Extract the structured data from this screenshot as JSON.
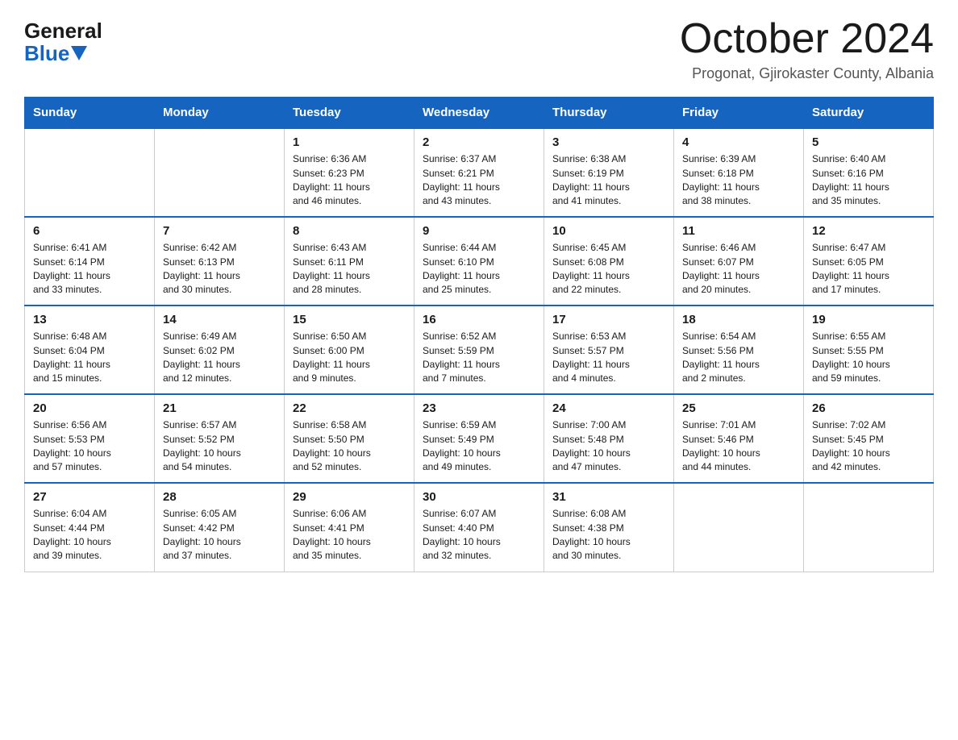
{
  "header": {
    "logo_general": "General",
    "logo_blue": "Blue",
    "title": "October 2024",
    "location": "Progonat, Gjirokaster County, Albania"
  },
  "days_of_week": [
    "Sunday",
    "Monday",
    "Tuesday",
    "Wednesday",
    "Thursday",
    "Friday",
    "Saturday"
  ],
  "weeks": [
    [
      {
        "day": "",
        "info": []
      },
      {
        "day": "",
        "info": []
      },
      {
        "day": "1",
        "info": [
          "Sunrise: 6:36 AM",
          "Sunset: 6:23 PM",
          "Daylight: 11 hours",
          "and 46 minutes."
        ]
      },
      {
        "day": "2",
        "info": [
          "Sunrise: 6:37 AM",
          "Sunset: 6:21 PM",
          "Daylight: 11 hours",
          "and 43 minutes."
        ]
      },
      {
        "day": "3",
        "info": [
          "Sunrise: 6:38 AM",
          "Sunset: 6:19 PM",
          "Daylight: 11 hours",
          "and 41 minutes."
        ]
      },
      {
        "day": "4",
        "info": [
          "Sunrise: 6:39 AM",
          "Sunset: 6:18 PM",
          "Daylight: 11 hours",
          "and 38 minutes."
        ]
      },
      {
        "day": "5",
        "info": [
          "Sunrise: 6:40 AM",
          "Sunset: 6:16 PM",
          "Daylight: 11 hours",
          "and 35 minutes."
        ]
      }
    ],
    [
      {
        "day": "6",
        "info": [
          "Sunrise: 6:41 AM",
          "Sunset: 6:14 PM",
          "Daylight: 11 hours",
          "and 33 minutes."
        ]
      },
      {
        "day": "7",
        "info": [
          "Sunrise: 6:42 AM",
          "Sunset: 6:13 PM",
          "Daylight: 11 hours",
          "and 30 minutes."
        ]
      },
      {
        "day": "8",
        "info": [
          "Sunrise: 6:43 AM",
          "Sunset: 6:11 PM",
          "Daylight: 11 hours",
          "and 28 minutes."
        ]
      },
      {
        "day": "9",
        "info": [
          "Sunrise: 6:44 AM",
          "Sunset: 6:10 PM",
          "Daylight: 11 hours",
          "and 25 minutes."
        ]
      },
      {
        "day": "10",
        "info": [
          "Sunrise: 6:45 AM",
          "Sunset: 6:08 PM",
          "Daylight: 11 hours",
          "and 22 minutes."
        ]
      },
      {
        "day": "11",
        "info": [
          "Sunrise: 6:46 AM",
          "Sunset: 6:07 PM",
          "Daylight: 11 hours",
          "and 20 minutes."
        ]
      },
      {
        "day": "12",
        "info": [
          "Sunrise: 6:47 AM",
          "Sunset: 6:05 PM",
          "Daylight: 11 hours",
          "and 17 minutes."
        ]
      }
    ],
    [
      {
        "day": "13",
        "info": [
          "Sunrise: 6:48 AM",
          "Sunset: 6:04 PM",
          "Daylight: 11 hours",
          "and 15 minutes."
        ]
      },
      {
        "day": "14",
        "info": [
          "Sunrise: 6:49 AM",
          "Sunset: 6:02 PM",
          "Daylight: 11 hours",
          "and 12 minutes."
        ]
      },
      {
        "day": "15",
        "info": [
          "Sunrise: 6:50 AM",
          "Sunset: 6:00 PM",
          "Daylight: 11 hours",
          "and 9 minutes."
        ]
      },
      {
        "day": "16",
        "info": [
          "Sunrise: 6:52 AM",
          "Sunset: 5:59 PM",
          "Daylight: 11 hours",
          "and 7 minutes."
        ]
      },
      {
        "day": "17",
        "info": [
          "Sunrise: 6:53 AM",
          "Sunset: 5:57 PM",
          "Daylight: 11 hours",
          "and 4 minutes."
        ]
      },
      {
        "day": "18",
        "info": [
          "Sunrise: 6:54 AM",
          "Sunset: 5:56 PM",
          "Daylight: 11 hours",
          "and 2 minutes."
        ]
      },
      {
        "day": "19",
        "info": [
          "Sunrise: 6:55 AM",
          "Sunset: 5:55 PM",
          "Daylight: 10 hours",
          "and 59 minutes."
        ]
      }
    ],
    [
      {
        "day": "20",
        "info": [
          "Sunrise: 6:56 AM",
          "Sunset: 5:53 PM",
          "Daylight: 10 hours",
          "and 57 minutes."
        ]
      },
      {
        "day": "21",
        "info": [
          "Sunrise: 6:57 AM",
          "Sunset: 5:52 PM",
          "Daylight: 10 hours",
          "and 54 minutes."
        ]
      },
      {
        "day": "22",
        "info": [
          "Sunrise: 6:58 AM",
          "Sunset: 5:50 PM",
          "Daylight: 10 hours",
          "and 52 minutes."
        ]
      },
      {
        "day": "23",
        "info": [
          "Sunrise: 6:59 AM",
          "Sunset: 5:49 PM",
          "Daylight: 10 hours",
          "and 49 minutes."
        ]
      },
      {
        "day": "24",
        "info": [
          "Sunrise: 7:00 AM",
          "Sunset: 5:48 PM",
          "Daylight: 10 hours",
          "and 47 minutes."
        ]
      },
      {
        "day": "25",
        "info": [
          "Sunrise: 7:01 AM",
          "Sunset: 5:46 PM",
          "Daylight: 10 hours",
          "and 44 minutes."
        ]
      },
      {
        "day": "26",
        "info": [
          "Sunrise: 7:02 AM",
          "Sunset: 5:45 PM",
          "Daylight: 10 hours",
          "and 42 minutes."
        ]
      }
    ],
    [
      {
        "day": "27",
        "info": [
          "Sunrise: 6:04 AM",
          "Sunset: 4:44 PM",
          "Daylight: 10 hours",
          "and 39 minutes."
        ]
      },
      {
        "day": "28",
        "info": [
          "Sunrise: 6:05 AM",
          "Sunset: 4:42 PM",
          "Daylight: 10 hours",
          "and 37 minutes."
        ]
      },
      {
        "day": "29",
        "info": [
          "Sunrise: 6:06 AM",
          "Sunset: 4:41 PM",
          "Daylight: 10 hours",
          "and 35 minutes."
        ]
      },
      {
        "day": "30",
        "info": [
          "Sunrise: 6:07 AM",
          "Sunset: 4:40 PM",
          "Daylight: 10 hours",
          "and 32 minutes."
        ]
      },
      {
        "day": "31",
        "info": [
          "Sunrise: 6:08 AM",
          "Sunset: 4:38 PM",
          "Daylight: 10 hours",
          "and 30 minutes."
        ]
      },
      {
        "day": "",
        "info": []
      },
      {
        "day": "",
        "info": []
      }
    ]
  ]
}
